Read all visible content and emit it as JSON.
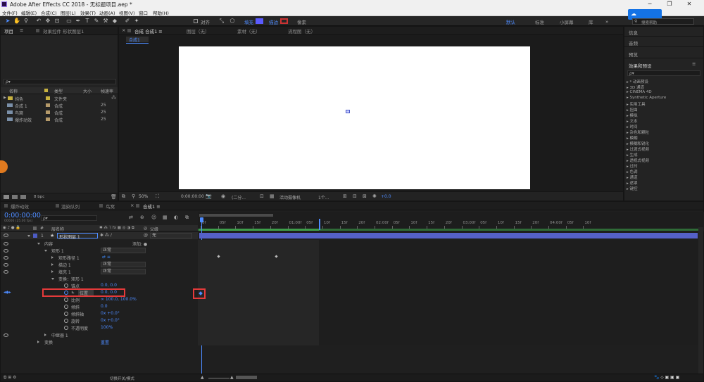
{
  "app": {
    "title": "Adobe After Effects CC 2018 - 无标题项目.aep *",
    "window_controls": [
      "─",
      "❐",
      "✕"
    ]
  },
  "menu": [
    "文件(F)",
    "编辑(E)",
    "合成(C)",
    "图层(L)",
    "效果(T)",
    "动画(A)",
    "视图(V)",
    "窗口",
    "帮助(H)"
  ],
  "toolbar": {
    "align_label": "对齐",
    "fill_label": "填充",
    "stroke_label": "描边",
    "pixel_label": "像素",
    "fill_color": "#5b5bff",
    "workspaces": [
      "默认",
      "标准",
      "小屏幕",
      "库"
    ],
    "active_workspace": "默认",
    "search_help": "搜索帮助"
  },
  "project_panel": {
    "tabs": [
      "项目",
      "效果控件 形状图层1"
    ],
    "search_placeholder": "ρ▾",
    "columns": {
      "name": "名称",
      "type": "类型",
      "size": "大小",
      "fps": "帧速率"
    },
    "items": [
      {
        "name": "纯色",
        "type": "文件夹",
        "fps": "",
        "color": "#c8b240",
        "icon": "folder-icon"
      },
      {
        "name": "合成 1",
        "type": "合成",
        "fps": "25",
        "color": "#b59a6a",
        "icon": "composition-icon"
      },
      {
        "name": "鸟窝",
        "type": "合成",
        "fps": "25",
        "color": "#b59a6a",
        "icon": "composition-icon"
      },
      {
        "name": "爆炸动效",
        "type": "合成",
        "fps": "25",
        "color": "#b59a6a",
        "icon": "composition-icon"
      }
    ],
    "bpc": "8 bpc"
  },
  "comp_panel": {
    "tabs": [
      "合成 合成1 ≡",
      "图层（无）",
      "素材（无）",
      "流程图（无）"
    ],
    "breadcrumb": "合成1",
    "footer": {
      "zoom": "50%",
      "timecode": "0:00:00:00",
      "resolution": "(二分...",
      "camera": "活动摄像机",
      "views": "1个...",
      "exposure": "+0.0"
    }
  },
  "right_panel": {
    "sections": [
      "信息",
      "音频",
      "预览",
      "效果和预设"
    ],
    "search_placeholder": "ρ▾",
    "effects": [
      "* 动画预设",
      "3D 通道",
      "CINEMA 4D",
      "Synthetic Aperture",
      "实用工具",
      "扭曲",
      "模拟",
      "文本",
      "时间",
      "杂色和颗粒",
      "模糊",
      "模糊和锐化",
      "过渡式视频",
      "生成",
      "透视式视频",
      "过时",
      "色调",
      "通道",
      "遮罩",
      "键控"
    ]
  },
  "timeline": {
    "tabs": [
      "爆炸动效",
      "渲染队列",
      "鸟窝",
      "合成1 ≡"
    ],
    "timecode": "0:00:00:00",
    "timecode_sub": "00000 (25.00 fps)",
    "search_placeholder": "ρ▾",
    "col_layer_name": "层名称",
    "col_parent": "父级",
    "layer": {
      "num": "1",
      "name": "形状图层 1",
      "mode": "正常",
      "parent": "无"
    },
    "rows": [
      {
        "indent": 1,
        "twirl": "down",
        "label": "内容",
        "value": "",
        "value_type": "add",
        "value_text": "添加: ●"
      },
      {
        "indent": 2,
        "twirl": "down",
        "label": "矩形 1",
        "value_type": "dropdown",
        "value_text": "正常"
      },
      {
        "indent": 3,
        "twirl": "right",
        "label": "矩形路径 1",
        "value_type": "icon",
        "value_text": "⇄ ≡"
      },
      {
        "indent": 3,
        "twirl": "right",
        "label": "描边 1",
        "value_type": "dropdown",
        "value_text": "正常"
      },
      {
        "indent": 3,
        "twirl": "right",
        "label": "填充 1",
        "value_type": "dropdown",
        "value_text": "正常"
      },
      {
        "indent": 3,
        "twirl": "down",
        "label": "变换：矩形 1",
        "value_type": "none",
        "value_text": ""
      },
      {
        "indent": 4,
        "stopwatch": true,
        "label": "锚点",
        "value_type": "blue",
        "value_text": "0.0, 0.0"
      },
      {
        "indent": 4,
        "stopwatch": true,
        "label": "位置",
        "value_type": "blue",
        "value_text": "0.0, 0.0",
        "highlight": true
      },
      {
        "indent": 4,
        "stopwatch": true,
        "label": "比例",
        "value_type": "blue",
        "value_text": "∞ 100.0, 100.0%"
      },
      {
        "indent": 4,
        "stopwatch": true,
        "label": "倾斜",
        "value_type": "blue",
        "value_text": "0.0"
      },
      {
        "indent": 4,
        "stopwatch": true,
        "label": "倾斜轴",
        "value_type": "blue",
        "value_text": "0x +0.0°"
      },
      {
        "indent": 4,
        "stopwatch": true,
        "label": "旋转",
        "value_type": "blue",
        "value_text": "0x +0.0°"
      },
      {
        "indent": 4,
        "stopwatch": true,
        "label": "不透明度",
        "value_type": "blue",
        "value_text": "100%"
      },
      {
        "indent": 2,
        "twirl": "right",
        "label": "中继器 1",
        "value_type": "none",
        "value_text": ""
      },
      {
        "indent": 1,
        "twirl": "right",
        "label": "变换",
        "value_type": "blue",
        "value_text": "重置"
      }
    ],
    "ruler": [
      "0f",
      "05f",
      "10f",
      "15f",
      "20f",
      "01:00f",
      "05f",
      "10f",
      "15f",
      "20f",
      "02:00f",
      "05f",
      "10f",
      "15f",
      "20f",
      "03:00f",
      "05f",
      "10f",
      "15f",
      "20f",
      "04:00f",
      "05f",
      "10f"
    ],
    "footer_label": "切换开关/模式"
  },
  "colors": {
    "accent": "#4d8bff",
    "highlight_box": "#e53a3a",
    "layer_bar": "#5561c8",
    "work_area": "#3e9e4a"
  }
}
